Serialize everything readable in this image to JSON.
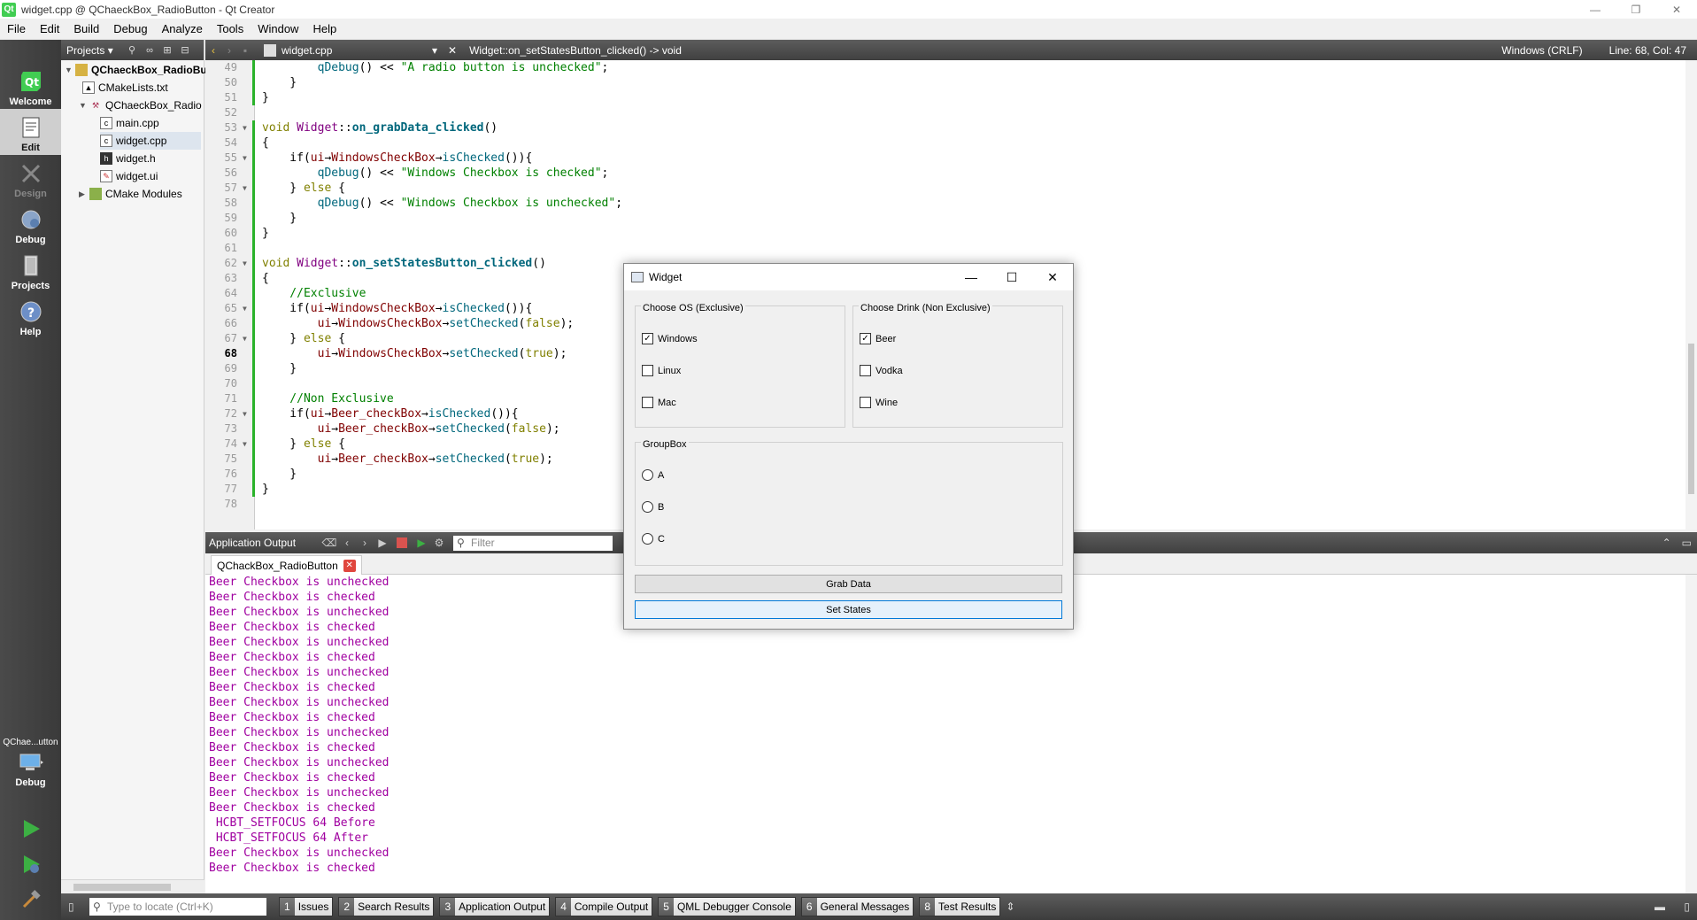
{
  "window": {
    "title": "widget.cpp @ QChaeckBox_RadioButton - Qt Creator",
    "app_icon": "Qt",
    "minimize": "—",
    "maximize": "❐",
    "close": "✕"
  },
  "menu": [
    "File",
    "Edit",
    "Build",
    "Debug",
    "Analyze",
    "Tools",
    "Window",
    "Help"
  ],
  "modes": [
    {
      "label": "Welcome"
    },
    {
      "label": "Edit"
    },
    {
      "label": "Design"
    },
    {
      "label": "Debug"
    },
    {
      "label": "Projects"
    },
    {
      "label": "Help"
    }
  ],
  "kit": {
    "name": "QChae...utton",
    "mode": "Debug"
  },
  "projects": {
    "selector": "Projects",
    "tree": [
      {
        "label": "QChaeckBox_RadioBu"
      },
      {
        "label": "CMakeLists.txt"
      },
      {
        "label": "QChaeckBox_Radio"
      },
      {
        "label": "main.cpp"
      },
      {
        "label": "widget.cpp"
      },
      {
        "label": "widget.h"
      },
      {
        "label": "widget.ui"
      },
      {
        "label": "CMake Modules"
      }
    ]
  },
  "editor": {
    "filename": "widget.cpp",
    "function": "Widget::on_setStatesButton_clicked() -> void",
    "line_ending": "Windows (CRLF)",
    "position": "Line: 68, Col: 47",
    "line_numbers": [
      "49",
      "50",
      "51",
      "52",
      "53",
      "54",
      "55",
      "56",
      "57",
      "58",
      "59",
      "60",
      "61",
      "62",
      "63",
      "64",
      "65",
      "66",
      "67",
      "68",
      "69",
      "70",
      "71",
      "72",
      "73",
      "74",
      "75",
      "76",
      "77",
      "78"
    ],
    "code": {
      "l49_a": "qDebug",
      "l49_b": "() << ",
      "l49_c": "\"A radio button is unchecked\"",
      "l49_d": ";",
      "l50": "    }",
      "l51": "}",
      "l53_a": "void ",
      "l53_b": "Widget",
      "l53_c": "::",
      "l53_d": "on_grabData_clicked",
      "l53_e": "()",
      "l54": "{",
      "l55_a": "    if(",
      "l55_b": "ui",
      "l55_c": "→",
      "l55_d": "WindowsCheckBox",
      "l55_e": "→",
      "l55_f": "isChecked",
      "l55_g": "()){",
      "l56_a": "qDebug",
      "l56_b": "() << ",
      "l56_c": "\"Windows Checkbox is checked\"",
      "l56_d": ";",
      "l57_a": "    } ",
      "l57_b": "else",
      "l57_c": " {",
      "l58_a": "qDebug",
      "l58_b": "() << ",
      "l58_c": "\"Windows Checkbox is unchecked\"",
      "l58_d": ";",
      "l59": "    }",
      "l60": "}",
      "l62_a": "void ",
      "l62_b": "Widget",
      "l62_c": "::",
      "l62_d": "on_setStatesButton_clicked",
      "l62_e": "()",
      "l63": "{",
      "l64": "    //Exclusive",
      "l65_a": "    if(",
      "l65_b": "ui",
      "l65_c": "→",
      "l65_d": "WindowsCheckBox",
      "l65_e": "→",
      "l65_f": "isChecked",
      "l65_g": "()){",
      "l66_a": "ui",
      "l66_b": "→",
      "l66_c": "WindowsCheckBox",
      "l66_d": "→",
      "l66_e": "setChecked",
      "l66_f": "(",
      "l66_g": "false",
      "l66_h": ");",
      "l67_a": "    } ",
      "l67_b": "else",
      "l67_c": " {",
      "l68_a": "ui",
      "l68_b": "→",
      "l68_c": "WindowsCheckBox",
      "l68_d": "→",
      "l68_e": "setChecked",
      "l68_f": "(",
      "l68_g": "true",
      "l68_h": ");",
      "l69": "    }",
      "l71": "    //Non Exclusive",
      "l72_a": "    if(",
      "l72_b": "ui",
      "l72_c": "→",
      "l72_d": "Beer_checkBox",
      "l72_e": "→",
      "l72_f": "isChecked",
      "l72_g": "()){",
      "l73_a": "ui",
      "l73_b": "→",
      "l73_c": "Beer_checkBox",
      "l73_d": "→",
      "l73_e": "setChecked",
      "l73_f": "(",
      "l73_g": "false",
      "l73_h": ");",
      "l74_a": "    } ",
      "l74_b": "else",
      "l74_c": " {",
      "l75_a": "ui",
      "l75_b": "→",
      "l75_c": "Beer_checkBox",
      "l75_d": "→",
      "l75_e": "setChecked",
      "l75_f": "(",
      "l75_g": "true",
      "l75_h": ");",
      "l76": "    }",
      "l77": "}"
    }
  },
  "output": {
    "title": "Application Output",
    "filter_placeholder": "Filter",
    "tab": "QChackBox_RadioButton",
    "lines": [
      "Beer Checkbox is unchecked",
      "Beer Checkbox is checked",
      "Beer Checkbox is unchecked",
      "Beer Checkbox is checked",
      "Beer Checkbox is unchecked",
      "Beer Checkbox is checked",
      "Beer Checkbox is unchecked",
      "Beer Checkbox is checked",
      "Beer Checkbox is unchecked",
      "Beer Checkbox is checked",
      "Beer Checkbox is unchecked",
      "Beer Checkbox is checked",
      "Beer Checkbox is unchecked",
      "Beer Checkbox is checked",
      "Beer Checkbox is unchecked",
      "Beer Checkbox is checked",
      " HCBT_SETFOCUS 64 Before",
      " HCBT_SETFOCUS 64 After",
      "Beer Checkbox is unchecked",
      "Beer Checkbox is checked"
    ]
  },
  "statusbar": {
    "locate_placeholder": "Type to locate (Ctrl+K)",
    "panes": [
      {
        "num": "1",
        "label": "Issues"
      },
      {
        "num": "2",
        "label": "Search Results"
      },
      {
        "num": "3",
        "label": "Application Output"
      },
      {
        "num": "4",
        "label": "Compile Output"
      },
      {
        "num": "5",
        "label": "QML Debugger Console"
      },
      {
        "num": "6",
        "label": "General Messages"
      },
      {
        "num": "8",
        "label": "Test Results"
      }
    ]
  },
  "widget": {
    "title": "Widget",
    "os_group": "Choose OS (Exclusive)",
    "os": [
      {
        "label": "Windows",
        "checked": true
      },
      {
        "label": "Linux",
        "checked": false
      },
      {
        "label": "Mac",
        "checked": false
      }
    ],
    "drink_group": "Choose Drink (Non Exclusive)",
    "drinks": [
      {
        "label": "Beer",
        "checked": true
      },
      {
        "label": "Vodka",
        "checked": false
      },
      {
        "label": "Wine",
        "checked": false
      }
    ],
    "radio_group": "GroupBox",
    "radios": [
      {
        "label": "A"
      },
      {
        "label": "B"
      },
      {
        "label": "C"
      }
    ],
    "grab_button": "Grab Data",
    "set_button": "Set States",
    "check_mark": "✓"
  }
}
